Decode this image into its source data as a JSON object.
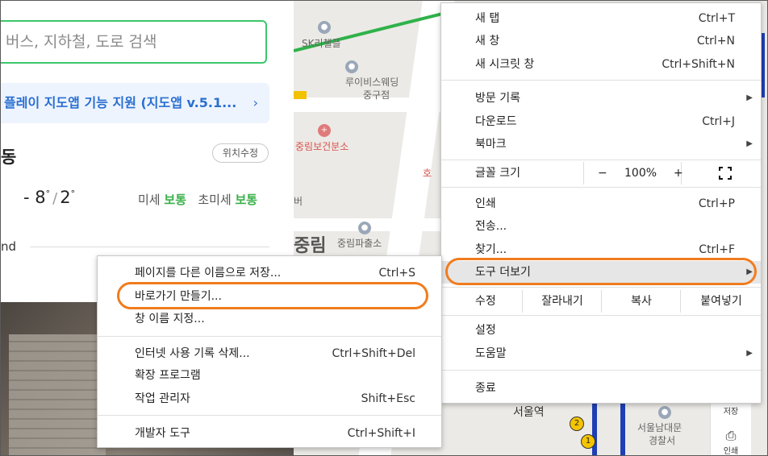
{
  "left_panel": {
    "search_text": "버스, 지하철, 도로 검색",
    "banner_text": "플레이 지도앱 기능 지원 (지도앱 v.5.1...",
    "banner_chevron": "›",
    "place_name": "동",
    "location_button": "위치수정",
    "temp_low": "- 8",
    "temp_high": "2",
    "degree": "°",
    "fine_dust_label": "미세",
    "fine_dust_value": "보통",
    "ultrafine_dust_label": "초미세",
    "ultrafine_dust_value": "보통",
    "partial_text": "nd"
  },
  "map": {
    "labels": {
      "sk": "SK리첼플",
      "wedding": "루이비스웨딩",
      "junggu": "중구점",
      "health": "중림보건분소",
      "police": "중림파출소",
      "hotel_partial": "호",
      "area_big": "중림",
      "station": "서울역",
      "police_box": "서울남대문",
      "police_box2": "경찰서",
      "ber": "버"
    },
    "badges": {
      "line2": "2",
      "line1": "1"
    },
    "side_tools": {
      "save_label": "저장",
      "print_label": "인쇄"
    }
  },
  "menu": {
    "new_tab": {
      "label": "새 탭",
      "shortcut": "Ctrl+T"
    },
    "new_window": {
      "label": "새 창",
      "shortcut": "Ctrl+N"
    },
    "incognito": {
      "label": "새 시크릿 창",
      "shortcut": "Ctrl+Shift+N"
    },
    "history": {
      "label": "방문 기록"
    },
    "downloads": {
      "label": "다운로드",
      "shortcut": "Ctrl+J"
    },
    "bookmarks": {
      "label": "북마크"
    },
    "zoom": {
      "label": "글꼴 크기",
      "minus": "−",
      "value": "100%",
      "plus": "+"
    },
    "print": {
      "label": "인쇄",
      "shortcut": "Ctrl+P"
    },
    "cast": {
      "label": "전송..."
    },
    "find": {
      "label": "찾기...",
      "shortcut": "Ctrl+F"
    },
    "more_tools": {
      "label": "도구 더보기"
    },
    "edit": {
      "label": "수정",
      "cut": "잘라내기",
      "copy": "복사",
      "paste": "붙여넣기"
    },
    "settings": {
      "label": "설정"
    },
    "help": {
      "label": "도움말"
    },
    "exit": {
      "label": "종료"
    },
    "arrow": "▶"
  },
  "submenu": {
    "save_as": {
      "label": "페이지를 다른 이름으로 저장...",
      "shortcut": "Ctrl+S"
    },
    "create_shortcut": {
      "label": "바로가기 만들기..."
    },
    "name_window": {
      "label": "창 이름 지정..."
    },
    "clear_data": {
      "label": "인터넷 사용 기록 삭제...",
      "shortcut": "Ctrl+Shift+Del"
    },
    "extensions": {
      "label": "확장 프로그램"
    },
    "task_manager": {
      "label": "작업 관리자",
      "shortcut": "Shift+Esc"
    },
    "dev_tools": {
      "label": "개발자 도구",
      "shortcut": "Ctrl+Shift+I"
    }
  },
  "colors": {
    "highlight": "#f07c1e",
    "search_border": "#3cc76b",
    "banner_text": "#2a6fd1",
    "dust_good": "#3bb14a"
  }
}
